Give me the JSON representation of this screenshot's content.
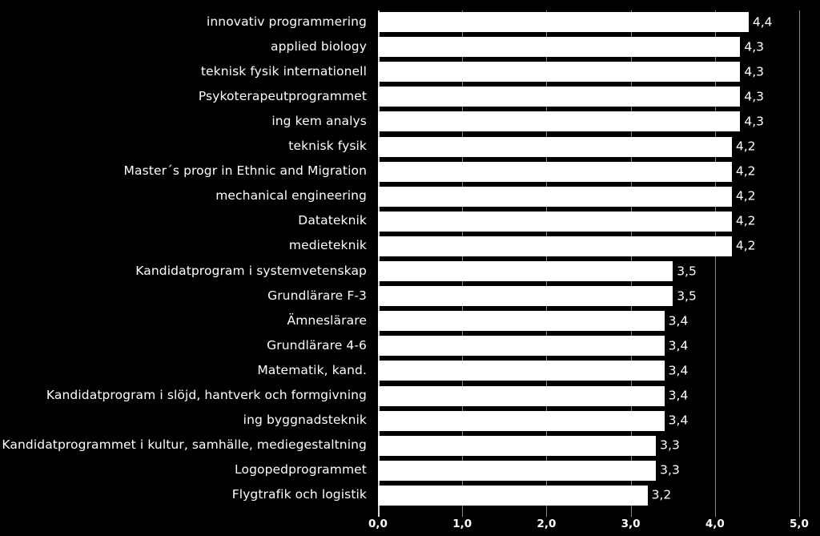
{
  "chart_data": {
    "type": "bar",
    "orientation": "horizontal",
    "title": "",
    "subtitle": "",
    "xlabel": "",
    "ylabel": "",
    "xlim": [
      0,
      5
    ],
    "xticks": [
      "0,0",
      "1,0",
      "2,0",
      "3,0",
      "4,0",
      "5,0"
    ],
    "xtick_values": [
      0,
      1,
      2,
      3,
      4,
      5
    ],
    "grid": true,
    "legend": false,
    "decimal_separator": ",",
    "categories": [
      "innovativ programmering",
      "applied biology",
      "teknisk fysik internationell",
      "Psykoterapeutprogrammet",
      "ing kem analys",
      "teknisk fysik",
      "Master´s progr in Ethnic and Migration",
      "mechanical engineering",
      "Datateknik",
      "medieteknik",
      "Kandidatprogram i systemvetenskap",
      "Grundlärare F-3",
      "Ämneslärare",
      "Grundlärare 4-6",
      "Matematik, kand.",
      "Kandidatprogram i slöjd, hantverk och formgivning",
      "ing byggnadsteknik",
      "Kandidatprogrammet i kultur, samhälle, mediegestaltning",
      "Logopedprogrammet",
      "Flygtrafik och logistik"
    ],
    "values": [
      4.4,
      4.3,
      4.3,
      4.3,
      4.3,
      4.2,
      4.2,
      4.2,
      4.2,
      4.2,
      3.5,
      3.5,
      3.4,
      3.4,
      3.4,
      3.4,
      3.4,
      3.3,
      3.3,
      3.2
    ],
    "value_labels": [
      "4,4",
      "4,3",
      "4,3",
      "4,3",
      "4,3",
      "4,2",
      "4,2",
      "4,2",
      "4,2",
      "4,2",
      "3,5",
      "3,5",
      "3,4",
      "3,4",
      "3,4",
      "3,4",
      "3,4",
      "3,3",
      "3,3",
      "3,2"
    ],
    "colors": {
      "background": "#000000",
      "bar": "#ffffff",
      "text": "#ffffff",
      "gridline": "#8a8a8a",
      "axis": "#d9d9d9"
    }
  }
}
